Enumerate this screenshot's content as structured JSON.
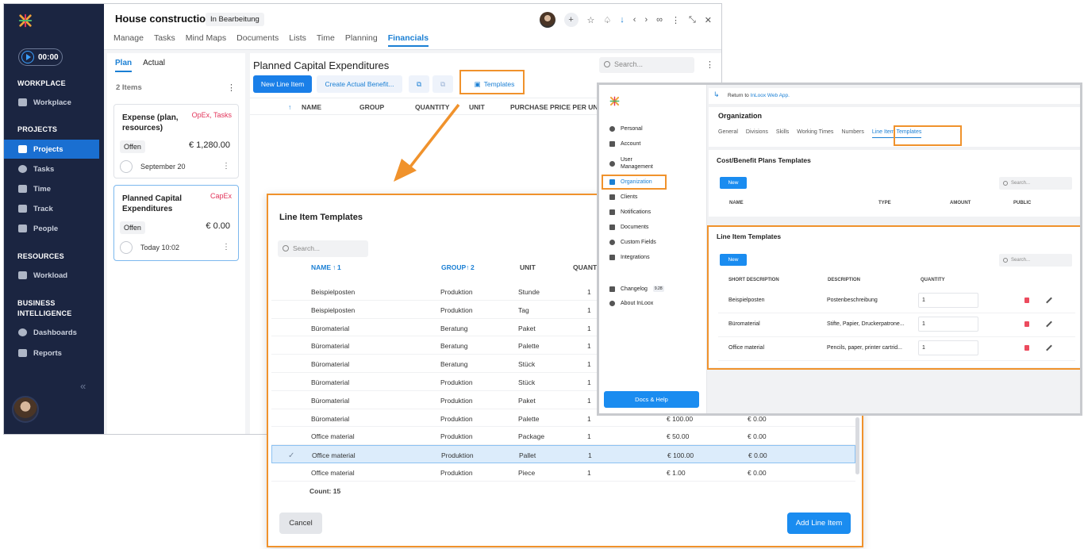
{
  "app": {
    "project_title": "House construction",
    "status": "In Bearbeitung",
    "timer": "00:00",
    "tabs": [
      "Manage",
      "Tasks",
      "Mind Maps",
      "Documents",
      "Lists",
      "Time",
      "Planning",
      "Financials"
    ],
    "active_tab": "Financials",
    "sidebar": {
      "workplace_header": "WORKPLACE",
      "workplace": "Workplace",
      "projects_header": "PROJECTS",
      "projects": "Projects",
      "tasks": "Tasks",
      "time": "Time",
      "track": "Track",
      "people": "People",
      "resources_header": "RESOURCES",
      "workload": "Workload",
      "bi_header_1": "BUSINESS",
      "bi_header_2": "INTELLIGENCE",
      "dashboards": "Dashboards",
      "reports": "Reports"
    },
    "plan": {
      "tab_plan": "Plan",
      "tab_actual": "Actual",
      "items_count": "2 Items",
      "cards": [
        {
          "title": "Expense (plan, resources)",
          "tag": "OpEx, Tasks",
          "status": "Offen",
          "amount": "€ 1,280.00",
          "date": "September 20"
        },
        {
          "title": "Planned Capital Expenditures",
          "tag": "CapEx",
          "status": "Offen",
          "amount": "€ 0.00",
          "date": "Today 10:02"
        }
      ]
    },
    "panel": {
      "title": "Planned Capital Expenditures",
      "search_placeholder": "Search...",
      "new_line_item": "New Line Item",
      "create_actual": "Create Actual Benefit...",
      "templates": "Templates",
      "columns": [
        "NAME",
        "GROUP",
        "QUANTITY",
        "UNIT",
        "PURCHASE PRICE PER UNIT"
      ]
    }
  },
  "dialog": {
    "title": "Line Item Templates",
    "search_placeholder": "Search...",
    "columns": {
      "name": "NAME",
      "name_sort": "1",
      "group": "GROUP",
      "group_sort": "2",
      "unit": "UNIT",
      "quantity": "QUANTI"
    },
    "rows": [
      {
        "name": "Beispielposten",
        "group": "Produktion",
        "unit": "Stunde",
        "qty": "1",
        "price": "",
        "cost": ""
      },
      {
        "name": "Beispielposten",
        "group": "Produktion",
        "unit": "Tag",
        "qty": "1",
        "price": "",
        "cost": ""
      },
      {
        "name": "Büromaterial",
        "group": "Beratung",
        "unit": "Paket",
        "qty": "1",
        "price": "",
        "cost": ""
      },
      {
        "name": "Büromaterial",
        "group": "Beratung",
        "unit": "Palette",
        "qty": "1",
        "price": "",
        "cost": ""
      },
      {
        "name": "Büromaterial",
        "group": "Beratung",
        "unit": "Stück",
        "qty": "1",
        "price": "",
        "cost": ""
      },
      {
        "name": "Büromaterial",
        "group": "Produktion",
        "unit": "Stück",
        "qty": "1",
        "price": "",
        "cost": ""
      },
      {
        "name": "Büromaterial",
        "group": "Produktion",
        "unit": "Paket",
        "qty": "1",
        "price": "",
        "cost": ""
      },
      {
        "name": "Büromaterial",
        "group": "Produktion",
        "unit": "Palette",
        "qty": "1",
        "price": "€ 100.00",
        "cost": "€ 0.00"
      },
      {
        "name": "Office material",
        "group": "Produktion",
        "unit": "Package",
        "qty": "1",
        "price": "€ 50.00",
        "cost": "€ 0.00"
      },
      {
        "name": "Office material",
        "group": "Produktion",
        "unit": "Pallet",
        "qty": "1",
        "price": "€ 100.00",
        "cost": "€ 0.00"
      },
      {
        "name": "Office material",
        "group": "Produktion",
        "unit": "Piece",
        "qty": "1",
        "price": "€ 1.00",
        "cost": "€ 0.00"
      }
    ],
    "selected_row": 9,
    "count": "Count: 15",
    "cancel": "Cancel",
    "add": "Add Line Item"
  },
  "settings": {
    "nav": [
      "Personal",
      "Account",
      "User Management",
      "Organization",
      "Clients",
      "Notifications",
      "Documents",
      "Custom Fields",
      "Integrations",
      "Changelog",
      "About InLoox"
    ],
    "changelog_badge": "9.28",
    "active_nav": "Organization",
    "docs_help": "Docs & Help",
    "return_text": "Return to",
    "return_link": "InLoox Web App.",
    "org_title": "Organization",
    "org_tabs": [
      "General",
      "Divisions",
      "Skills",
      "Working Times",
      "Numbers",
      "Line Item Templates"
    ],
    "cost_title": "Cost/Benefit Plans Templates",
    "new_label": "New",
    "search_placeholder": "Search...",
    "cost_columns": [
      "NAME",
      "TYPE",
      "AMOUNT",
      "PUBLIC"
    ],
    "li_title": "Line Item Templates",
    "li_columns": [
      "SHORT DESCRIPTION",
      "DESCRIPTION",
      "QUANTITY"
    ],
    "li_rows": [
      {
        "short": "Beispielposten",
        "desc": "Postenbeschreibung",
        "qty": "1"
      },
      {
        "short": "Büromaterial",
        "desc": "Stifte, Papier, Druckerpatrone...",
        "qty": "1"
      },
      {
        "short": "Office material",
        "desc": "Pencils, paper, printer cartrid...",
        "qty": "1"
      }
    ]
  },
  "colors": {
    "accent": "#1a7fe8",
    "callout": "#f0922c",
    "sidebar": "#1b2541",
    "danger": "#e2345a"
  }
}
